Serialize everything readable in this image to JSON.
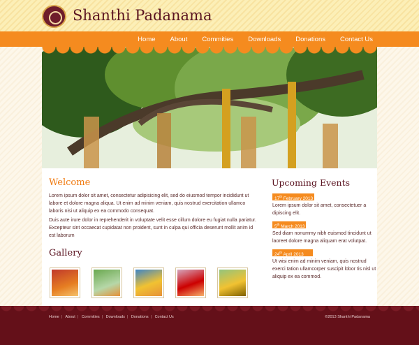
{
  "site": {
    "title": "Shanthi Padanama"
  },
  "nav": [
    "Home",
    "About",
    "Commities",
    "Downloads",
    "Donations",
    "Contact Us"
  ],
  "welcome": {
    "heading": "Welcome",
    "para1": "Lorem ipsum dolor sit amet, consectetur adipisicing elit, sed do eiusmod tempor incididunt ut labore et dolore magna aliqua. Ut enim ad minim veniam, quis nostrud exercitation ullamco laboris nisi ut aliquip ex ea commodo consequat.",
    "para2": "Duis aute irure dolor in reprehenderit in voluptate velit esse cillum dolore eu fugiat nulla pariatur. Excepteur sint occaecat cupidatat non proident, sunt in culpa qui officia deserunt mollit anim id est laborum"
  },
  "gallery": {
    "heading": "Gallery"
  },
  "events": {
    "heading": "Upcoming Events",
    "items": [
      {
        "day": "17",
        "suffix": "th",
        "rest": " February 2013",
        "text": "Lorem ipsum dolor sit amet, consectetuer a dipiscing elit."
      },
      {
        "day": "5",
        "suffix": "th",
        "rest": " March 2013",
        "text": "Sed diam nonummy nibh euismod tincidunt ut laoreet dolore magna aliquam erat volutpat."
      },
      {
        "day": "24",
        "suffix": "th",
        "rest": " April 2013",
        "text": "Ut wisi enim ad minim veniam, quis nostrud exerci tation ullamcorper suscipit lobor tis nisl ut aliquip ex ea commod."
      }
    ]
  },
  "footer": {
    "links": [
      "Home",
      "About",
      "Commities",
      "Downloads",
      "Donations",
      "Contact Us"
    ],
    "copyright": "©2013 Shanthi Padanama"
  },
  "colors": {
    "accent": "#f58b1f",
    "maroon": "#641019",
    "title": "#5a1320"
  },
  "icons": {
    "logo": "temple-emblem-logo"
  }
}
